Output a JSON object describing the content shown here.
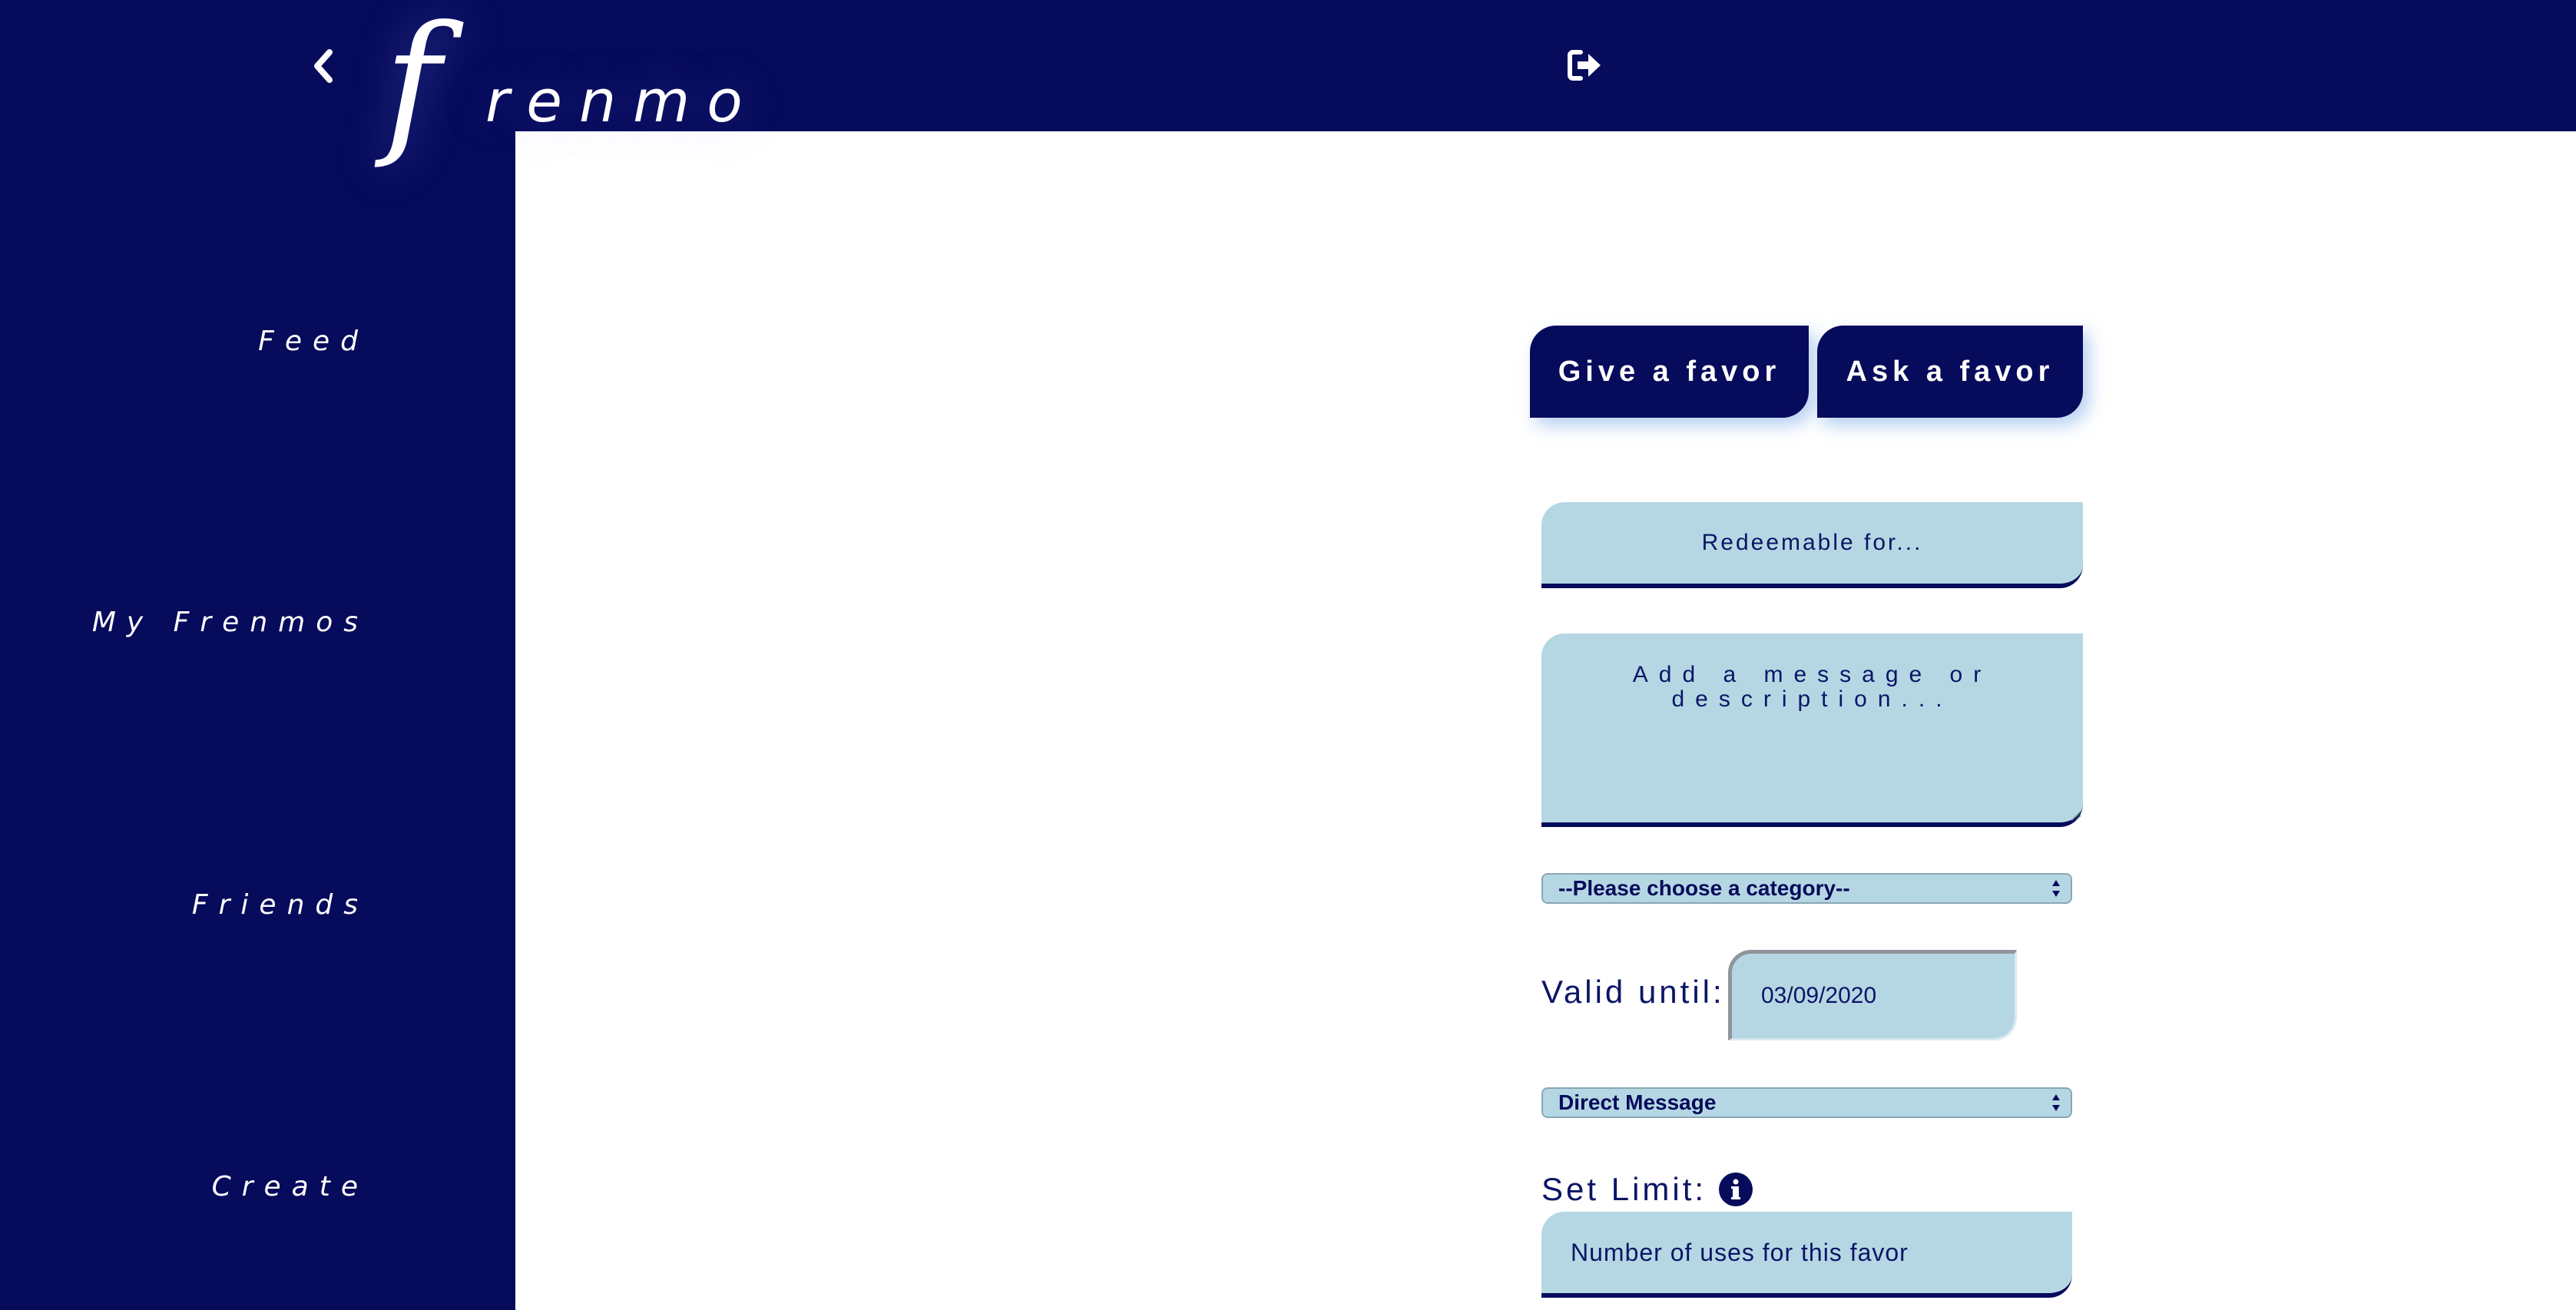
{
  "app": {
    "logo_first_letter": "f",
    "logo_rest": "renmo"
  },
  "header": {
    "back_icon": "chevron-left-icon",
    "logout_icon": "sign-out-icon"
  },
  "sidebar": {
    "items": [
      {
        "label": "Feed"
      },
      {
        "label": "My Frenmos"
      },
      {
        "label": "Friends"
      },
      {
        "label": "Create"
      }
    ]
  },
  "form": {
    "tabs": [
      {
        "label": "Give a favor"
      },
      {
        "label": "Ask a favor"
      }
    ],
    "redeemable_placeholder": "Redeemable for...",
    "message_placeholder": "Add a message or description...",
    "category_select": {
      "selected": "--Please choose a category--"
    },
    "valid_until_label": "Valid until:",
    "valid_until_value": "03/09/2020",
    "audience_select": {
      "selected": "Direct Message"
    },
    "set_limit_label": "Set Limit:",
    "limit_placeholder": "Number of uses for this favor"
  },
  "colors": {
    "navy": "#070b5b",
    "field_blue": "#b5d7e3",
    "text_navy": "#0b1566",
    "background": "#ffffff"
  }
}
